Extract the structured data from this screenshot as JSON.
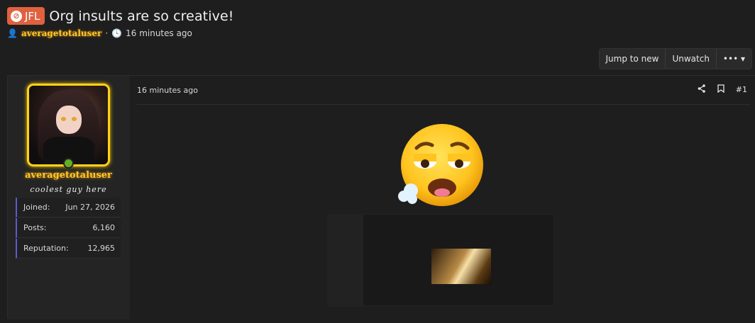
{
  "thread": {
    "prefix": "JFL",
    "title": "Org insults are so creative!",
    "author": "averagetotaluser",
    "time": "16 minutes ago"
  },
  "toolbar": {
    "jump_label": "Jump to new",
    "unwatch_label": "Unwatch",
    "more_label": "••• ▾"
  },
  "post": {
    "time": "16 minutes ago",
    "number": "#1",
    "share_icon": "share-icon",
    "bookmark_icon": "bookmark-icon"
  },
  "user": {
    "name": "averagetotaluser",
    "title": "coolest guy here",
    "stats": [
      {
        "label": "Joined:",
        "value": "Jun 27, 2026"
      },
      {
        "label": "Posts:",
        "value": "6,160"
      },
      {
        "label": "Reputation:",
        "value": "12,965"
      }
    ]
  },
  "colors": {
    "prefix": "#e0613f",
    "username": "#ffc72c",
    "online": "#63b021"
  }
}
